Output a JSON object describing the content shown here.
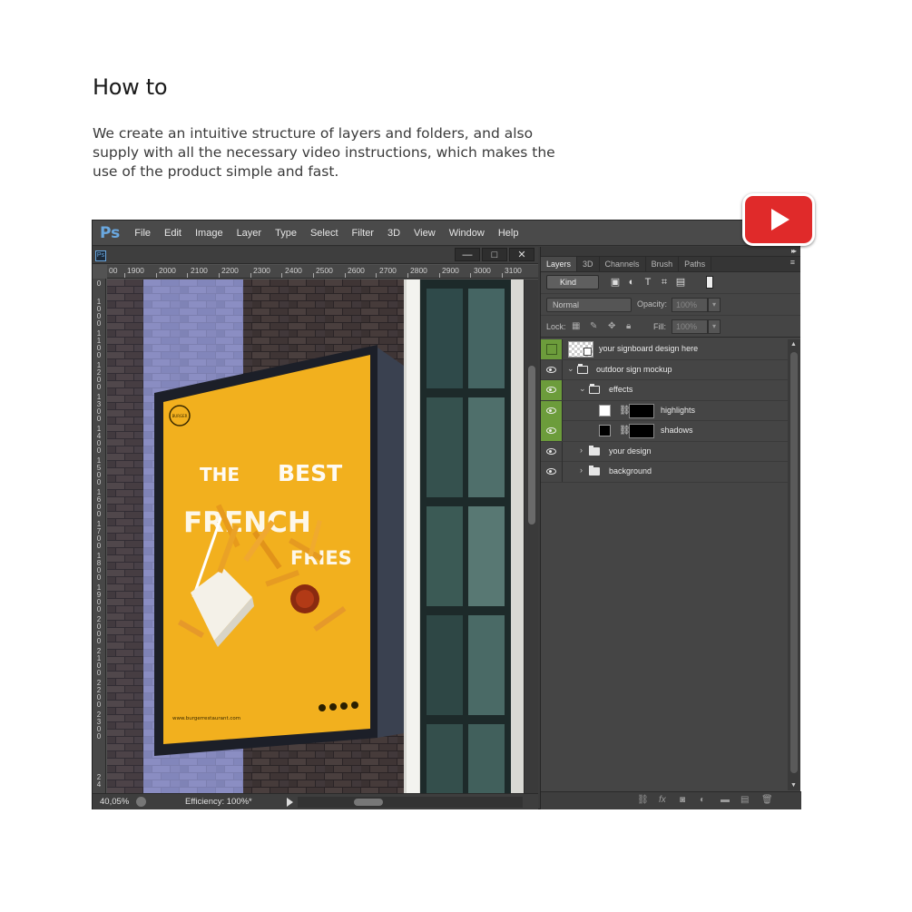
{
  "heading": "How to",
  "intro": "We create an intuitive structure of layers and folders, and also supply with all the necessary video instructions, which makes the use of the product simple and fast.",
  "youtube": {
    "icon": "youtube-play-icon",
    "color": "#e02a2a"
  },
  "app": {
    "logo": "Ps",
    "menu": [
      "File",
      "Edit",
      "Image",
      "Layer",
      "Type",
      "Select",
      "Filter",
      "3D",
      "View",
      "Window",
      "Help"
    ],
    "window_buttons": [
      "—",
      "□",
      "✕"
    ]
  },
  "document": {
    "ruler_h": [
      "00",
      "1900",
      "2000",
      "2100",
      "2200",
      "2300",
      "2400",
      "2500",
      "2600",
      "2700",
      "2800",
      "2900",
      "3000",
      "3100"
    ],
    "ruler_v": [
      "0",
      "1000",
      "1100",
      "1200",
      "1300",
      "1400",
      "1500",
      "1600",
      "1700",
      "1800",
      "1900",
      "2000",
      "2100",
      "2200",
      "2300",
      "24"
    ],
    "zoom": "40,05%",
    "status": "Efficiency: 100%*",
    "sign": {
      "line1a": "THE",
      "line1b": "BEST",
      "line2": "FRENCH",
      "line3": "FRIES",
      "url": "www.burgerrestaurant.com",
      "logo_text": "BURGER",
      "bg": "#f2b01e"
    }
  },
  "panels": {
    "tabs": [
      "Layers",
      "3D",
      "Channels",
      "Brush",
      "Paths"
    ],
    "kind": "Kind",
    "blend_mode": "Normal",
    "opacity_label": "Opacity:",
    "opacity_value": "100%",
    "lock_label": "Lock:",
    "fill_label": "Fill:",
    "fill_value": "100%",
    "layers": [
      {
        "name": "your signboard design here",
        "indent": 0,
        "type": "smart",
        "visible": false,
        "highlight": true
      },
      {
        "name": "outdoor sign mockup",
        "indent": 0,
        "type": "folder-open",
        "visible": true,
        "highlight": false
      },
      {
        "name": "effects",
        "indent": 1,
        "type": "folder-open",
        "visible": true,
        "highlight": true
      },
      {
        "name": "highlights",
        "indent": 2,
        "type": "white-mask",
        "visible": true,
        "highlight": true
      },
      {
        "name": "shadows",
        "indent": 2,
        "type": "black-mask",
        "visible": true,
        "highlight": true
      },
      {
        "name": "your design",
        "indent": 1,
        "type": "folder",
        "visible": true,
        "highlight": false
      },
      {
        "name": "background",
        "indent": 1,
        "type": "folder",
        "visible": true,
        "highlight": false
      }
    ],
    "highlight_color": "#6c9c3b"
  }
}
